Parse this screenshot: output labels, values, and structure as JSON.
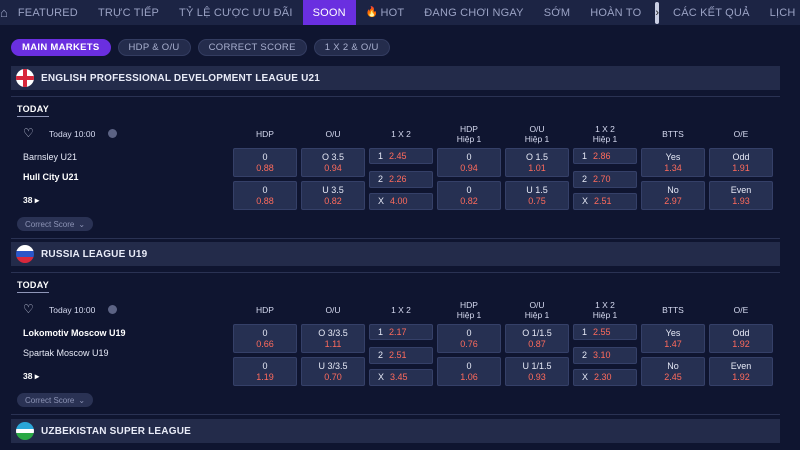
{
  "nav": {
    "items": [
      "FEATURED",
      "TRỰC TIẾP",
      "TỶ LỆ CƯỢC ƯU ĐÃI",
      "SOON",
      "HOT",
      "ĐANG CHƠI NGAY",
      "SỚM",
      "HOÀN TO",
      "CÁC KẾT QUẢ",
      "LỊCH"
    ],
    "active": "SOON"
  },
  "filters": [
    "MAIN MARKETS",
    "HDP & O/U",
    "CORRECT SCORE",
    "1 X 2 & O/U"
  ],
  "columns": {
    "hdp": "HDP",
    "ou": "O/U",
    "x12": "1 X 2",
    "hdp_h1": [
      "HDP",
      "Hiệp 1"
    ],
    "ou_h1": [
      "O/U",
      "Hiệp 1"
    ],
    "x12_h1": [
      "1 X 2",
      "Hiệp 1"
    ],
    "btts": "BTTS",
    "oe": "O/E"
  },
  "today_label": "TODAY",
  "correct_score_label": "Correct Score",
  "leagues": [
    {
      "name": "ENGLISH PROFESSIONAL DEVELOPMENT LEAGUE U21",
      "match": {
        "time": "Today 10:00",
        "home": "Barnsley U21",
        "away": "Hull City U21",
        "more": "38",
        "hdp": [
          {
            "line": "0",
            "odd": "0.88"
          },
          {
            "line": "0",
            "odd": "0.88"
          }
        ],
        "ou": [
          {
            "line": "O 3.5",
            "odd": "0.94"
          },
          {
            "line": "U 3.5",
            "odd": "0.82"
          }
        ],
        "x12": [
          {
            "k": "1",
            "odd": "2.45"
          },
          {
            "k": "2",
            "odd": "2.26"
          },
          {
            "k": "X",
            "odd": "4.00"
          }
        ],
        "hdp_h1": [
          {
            "line": "0",
            "odd": "0.94"
          },
          {
            "line": "0",
            "odd": "0.82"
          }
        ],
        "ou_h1": [
          {
            "line": "O 1.5",
            "odd": "1.01"
          },
          {
            "line": "U 1.5",
            "odd": "0.75"
          }
        ],
        "x12_h1": [
          {
            "k": "1",
            "odd": "2.86"
          },
          {
            "k": "2",
            "odd": "2.70"
          },
          {
            "k": "X",
            "odd": "2.51"
          }
        ],
        "btts": [
          {
            "line": "Yes",
            "odd": "1.34"
          },
          {
            "line": "No",
            "odd": "2.97"
          }
        ],
        "oe": [
          {
            "line": "Odd",
            "odd": "1.91"
          },
          {
            "line": "Even",
            "odd": "1.93"
          }
        ]
      }
    },
    {
      "name": "RUSSIA LEAGUE U19",
      "match": {
        "time": "Today 10:00",
        "home": "Lokomotiv Moscow U19",
        "away": "Spartak Moscow U19",
        "more": "38",
        "hdp": [
          {
            "line": "0",
            "odd": "0.66"
          },
          {
            "line": "0",
            "odd": "1.19"
          }
        ],
        "ou": [
          {
            "line": "O 3/3.5",
            "odd": "1.11"
          },
          {
            "line": "U 3/3.5",
            "odd": "0.70"
          }
        ],
        "x12": [
          {
            "k": "1",
            "odd": "2.17"
          },
          {
            "k": "2",
            "odd": "2.51"
          },
          {
            "k": "X",
            "odd": "3.45"
          }
        ],
        "hdp_h1": [
          {
            "line": "0",
            "odd": "0.76"
          },
          {
            "line": "0",
            "odd": "1.06"
          }
        ],
        "ou_h1": [
          {
            "line": "O 1/1.5",
            "odd": "0.87"
          },
          {
            "line": "U 1/1.5",
            "odd": "0.93"
          }
        ],
        "x12_h1": [
          {
            "k": "1",
            "odd": "2.55"
          },
          {
            "k": "2",
            "odd": "3.10"
          },
          {
            "k": "X",
            "odd": "2.30"
          }
        ],
        "btts": [
          {
            "line": "Yes",
            "odd": "1.47"
          },
          {
            "line": "No",
            "odd": "2.45"
          }
        ],
        "oe": [
          {
            "line": "Odd",
            "odd": "1.92"
          },
          {
            "line": "Even",
            "odd": "1.92"
          }
        ]
      }
    },
    {
      "name": "UZBEKISTAN SUPER LEAGUE"
    }
  ]
}
